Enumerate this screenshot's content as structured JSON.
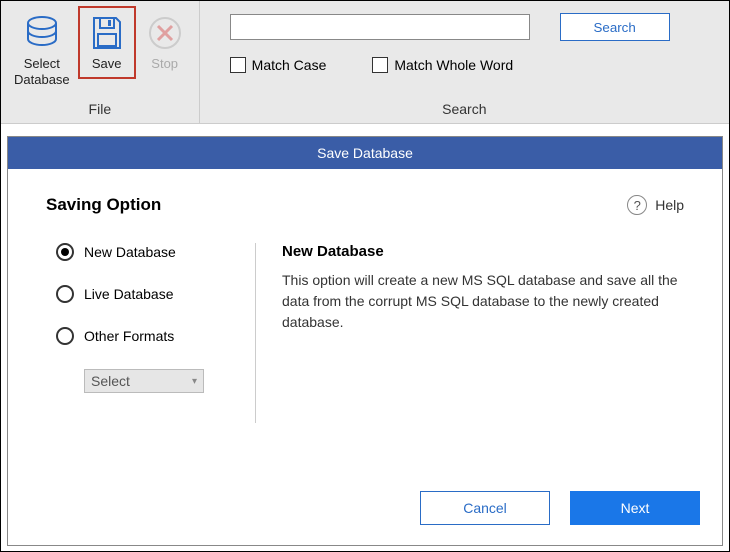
{
  "ribbon": {
    "file_group_label": "File",
    "search_group_label": "Search",
    "select_db_label": "Select\nDatabase",
    "save_label": "Save",
    "stop_label": "Stop"
  },
  "search": {
    "input_value": "",
    "search_button": "Search",
    "match_case": "Match Case",
    "match_whole": "Match Whole Word"
  },
  "dialog": {
    "title": "Save Database",
    "saving_option_heading": "Saving Option",
    "help_label": "Help",
    "options": {
      "new_db": "New Database",
      "live_db": "Live Database",
      "other_formats": "Other Formats"
    },
    "select_placeholder": "Select",
    "right": {
      "heading": "New Database",
      "body": "This option will create a new MS SQL database and save all the data from the corrupt MS SQL database to the newly created database."
    },
    "buttons": {
      "cancel": "Cancel",
      "next": "Next"
    }
  }
}
